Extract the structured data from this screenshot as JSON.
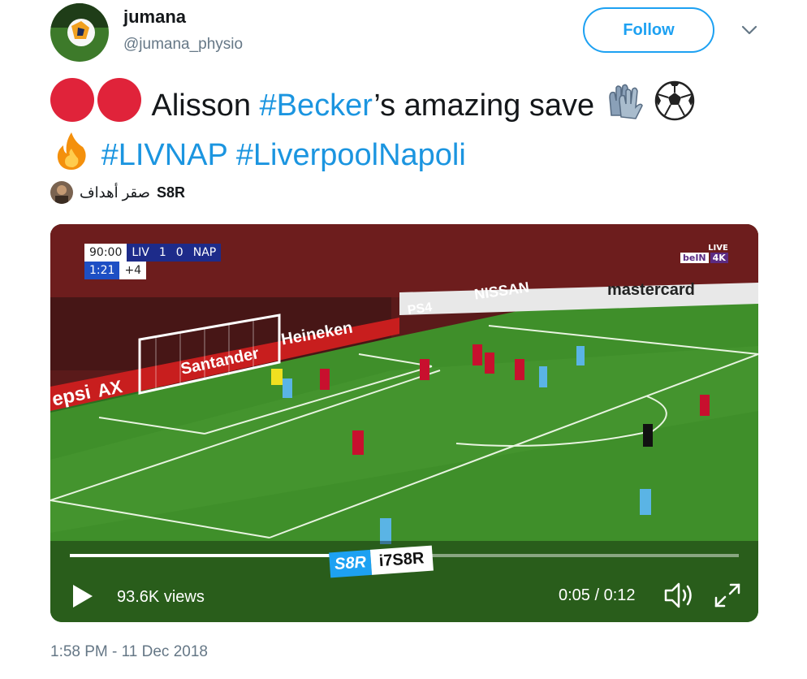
{
  "user": {
    "name": "jumana",
    "handle": "@jumana_physio",
    "follow_label": "Follow"
  },
  "tweet": {
    "line1_text": "Alisson ",
    "line1_hashtag": "#Becker",
    "line1_rest": "’s amazing save",
    "hashtag1": "#LIVNAP",
    "hashtag2": "#LiverpoolNapoli"
  },
  "attribution": {
    "arabic": "صقر أهداف",
    "source": "S8R"
  },
  "video": {
    "scoreboard": {
      "clock": "90:00",
      "home": "LIV",
      "home_score": "1",
      "away_score": "0",
      "away": "NAP",
      "added_clock": "1:21",
      "added": "+4"
    },
    "channel_live": "LIVE",
    "channel_name": "beIN",
    "channel_quality": "4K",
    "board_text": "mastercard",
    "ad_santander": "Santander",
    "ad_heineken": "Heineken",
    "ad_pepsi": "epsi",
    "ad_ax": "AX",
    "ad_nissan": "NISSAN",
    "ad_ps4": "PS4",
    "watermark_logo": "S8R",
    "watermark_text": "i7S8R",
    "views": "93.6K views",
    "time": "0:05 / 0:12",
    "progress_fraction": 0.42
  },
  "timestamp": "1:58 PM - 11 Dec 2018",
  "colors": {
    "accent": "#1da1f2",
    "hashtag": "#1b95e0",
    "secondary_text": "#657786",
    "red_dot": "#e0233a"
  },
  "icons": {
    "dots": "red-circle-icon",
    "gloves": "gloves-icon",
    "ball": "soccer-ball-icon",
    "fire": "fire-icon",
    "play": "play-icon",
    "volume": "volume-icon",
    "fullscreen": "fullscreen-icon",
    "caret": "chevron-down-icon"
  }
}
